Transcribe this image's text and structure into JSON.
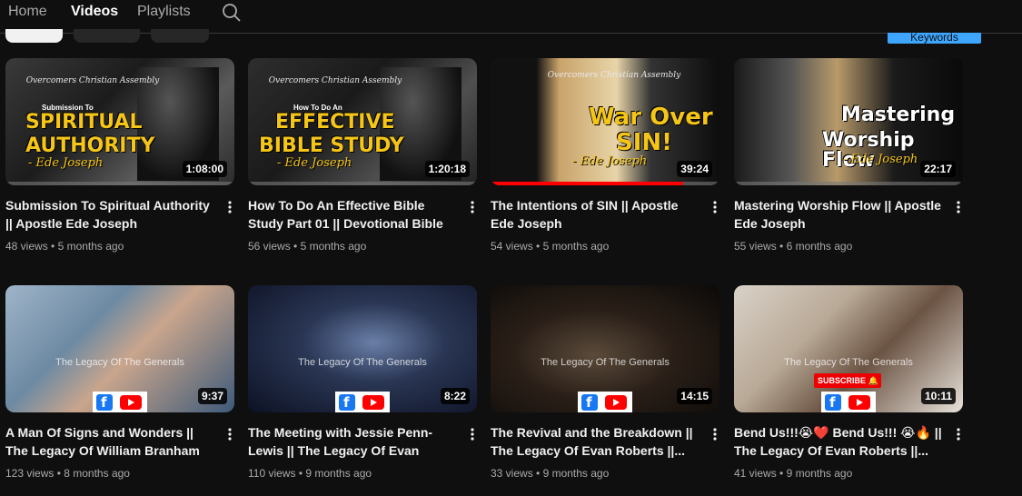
{
  "nav": {
    "tabs": [
      {
        "label": "Home"
      },
      {
        "label": "Videos"
      },
      {
        "label": "Playlists"
      }
    ],
    "active_tab": "Videos",
    "search_icon": "search-icon"
  },
  "filters": {
    "keywords_label": "Keywords"
  },
  "videos": [
    {
      "title": "Submission To Spiritual Authority || Apostle Ede Joseph",
      "views": "48 views",
      "age": "5 months ago",
      "duration": "1:08:00",
      "progress": 0,
      "thumb": {
        "brand": "Overcomers Christian Assembly",
        "small": "Submission To",
        "line1": "SPIRITUAL",
        "line2": "AUTHORITY",
        "sign": "- Ede Joseph"
      }
    },
    {
      "title": "How To Do An Effective Bible Study Part 01 || Devotional Bible Study ||...",
      "views": "56 views",
      "age": "5 months ago",
      "duration": "1:20:18",
      "progress": 0,
      "thumb": {
        "brand": "Overcomers Christian Assembly",
        "small": "How To Do An",
        "line1": "EFFECTIVE",
        "line2": "BIBLE STUDY",
        "sign": "- Ede Joseph"
      }
    },
    {
      "title": "The Intentions of SIN || Apostle Ede Joseph",
      "views": "54 views",
      "age": "5 months ago",
      "duration": "39:24",
      "progress": 0.84,
      "thumb": {
        "brand": "Overcomers Christian Assembly",
        "line1": "War Over",
        "line2": "SIN!",
        "sign": "- Ede Joseph"
      }
    },
    {
      "title": "Mastering Worship Flow || Apostle Ede Joseph",
      "views": "55 views",
      "age": "6 months ago",
      "duration": "22:17",
      "progress": 0,
      "thumb": {
        "line1": "Mastering",
        "line2": "Worship Flow",
        "sign": "- Ede Joseph"
      }
    },
    {
      "title": "A Man Of Signs and Wonders || The Legacy Of William Branham ||...",
      "views": "123 views",
      "age": "8 months ago",
      "duration": "9:37",
      "progress": 0,
      "thumb": {
        "legacy": "The Legacy Of The Generals"
      }
    },
    {
      "title": "The Meeting with Jessie Penn-Lewis || The Legacy Of Evan Rober...",
      "views": "110 views",
      "age": "9 months ago",
      "duration": "8:22",
      "progress": 0,
      "thumb": {
        "legacy": "The Legacy Of The Generals"
      }
    },
    {
      "title": "The Revival and the Breakdown || The Legacy Of Evan Roberts ||...",
      "views": "33 views",
      "age": "9 months ago",
      "duration": "14:15",
      "progress": 0,
      "thumb": {
        "legacy": "The Legacy Of The Generals"
      }
    },
    {
      "title": "Bend Us!!!😭❤️ Bend Us!!! 😭🔥 || The Legacy Of Evan Roberts ||...",
      "views": "41 views",
      "age": "9 months ago",
      "duration": "10:11",
      "progress": 0,
      "thumb": {
        "legacy": "The Legacy Of The Generals",
        "subscribe": "SUBSCRIBE 🔔"
      }
    }
  ],
  "colors": {
    "background": "#0f0f0f",
    "text": "#f1f1f1",
    "meta": "#aaaaaa",
    "progress": "#ff0000",
    "keywords": "#3ea6ff"
  }
}
